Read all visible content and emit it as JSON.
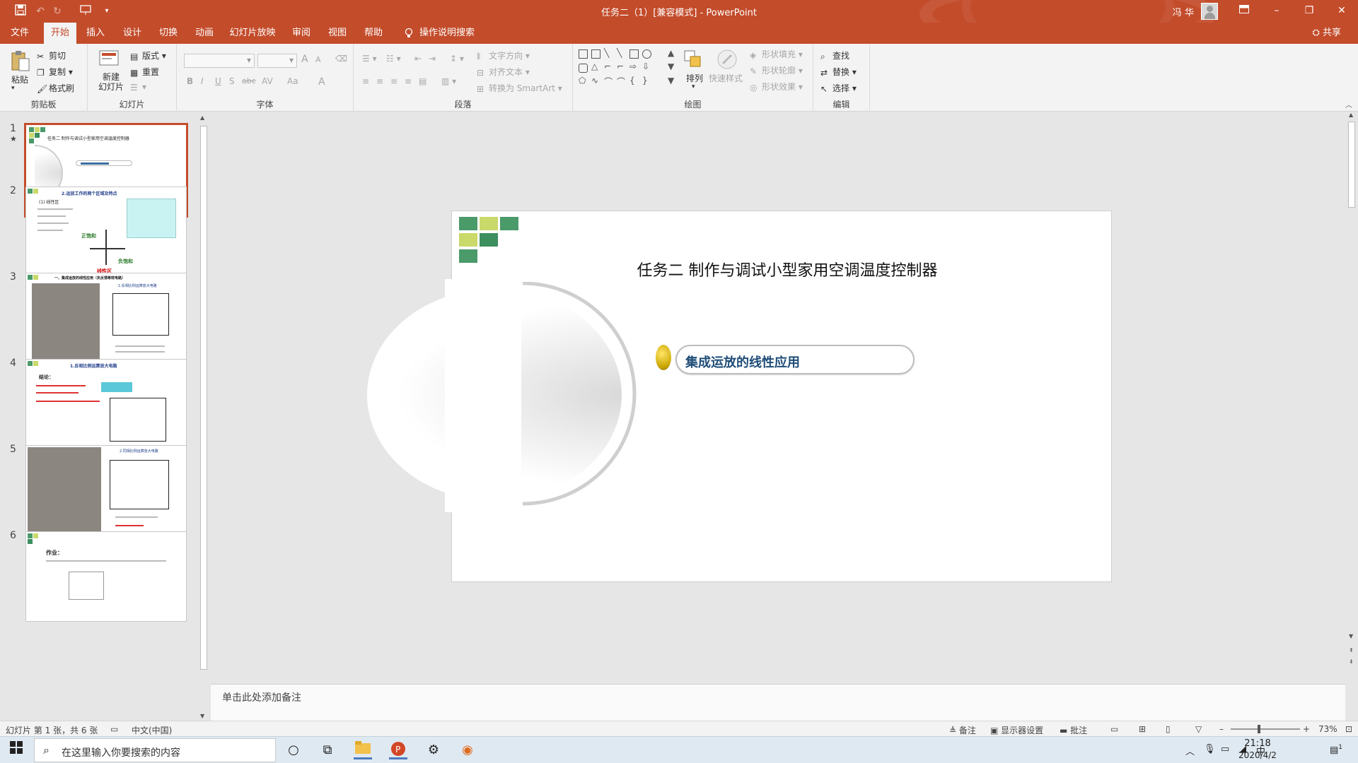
{
  "window": {
    "title": "任务二（1）[兼容模式] - PowerPoint",
    "user_name": "冯 华"
  },
  "quick_access": [
    "save-icon",
    "undo-icon",
    "redo-icon",
    "slideshow-start-icon",
    "customize-icon"
  ],
  "tabs": [
    "文件",
    "开始",
    "插入",
    "设计",
    "切换",
    "动画",
    "幻灯片放映",
    "审阅",
    "视图",
    "帮助",
    "操作说明搜索"
  ],
  "active_tab": "开始",
  "share_label": "共享",
  "ribbon": {
    "clipboard": {
      "paste": "粘贴",
      "cut": "剪切",
      "copy": "复制",
      "format_painter": "格式刷",
      "label": "剪贴板"
    },
    "slides": {
      "new_slide": "新建\n幻灯片",
      "layout": "版式",
      "reset": "重置",
      "label": "幻灯片"
    },
    "font": {
      "label": "字体",
      "bold": "B",
      "italic": "I",
      "underline": "U",
      "shadow": "S",
      "strike": "abc",
      "spacing": "AV",
      "case": "Aa",
      "color": "A",
      "grow": "A",
      "shrink": "A"
    },
    "paragraph": {
      "text_direction": "文字方向",
      "align_text": "对齐文本",
      "smartart": "转换为 SmartArt",
      "label": "段落"
    },
    "drawing": {
      "arrange": "排列",
      "quick_styles": "快速样式",
      "shape_fill": "形状填充",
      "shape_outline": "形状轮廓",
      "shape_effects": "形状效果",
      "label": "绘图"
    },
    "editing": {
      "find": "查找",
      "replace": "替换",
      "select": "选择",
      "label": "编辑"
    }
  },
  "thumbnails": [
    {
      "num": "1",
      "star": "★",
      "title": "任务二 制作与调试小型家用空调温度控制器"
    },
    {
      "num": "2",
      "title": "2.运放工作的两个区域及特点",
      "label_left": "(1) 线性区",
      "label_bottom": "线性区",
      "sat_pos": "正饱和",
      "sat_neg": "负饱和"
    },
    {
      "num": "3",
      "title": "一、集成运放的线性应用（负反馈等效电路）",
      "subtitle": "1.反相比例运算放大电路"
    },
    {
      "num": "4",
      "title": "1.反相比例运算放大电路",
      "note": "结论："
    },
    {
      "num": "5",
      "title": "2.同相比例运算放大电路"
    },
    {
      "num": "6",
      "title": "作业："
    }
  ],
  "slide": {
    "title": "任务二 制作与调试小型家用空调温度控制器",
    "pill_text": "集成运放的线性应用",
    "colors": {
      "dark_green": "#4a9a6a",
      "light_green": "#c9d96a",
      "mid_green": "#3d8f5e"
    }
  },
  "notes_placeholder": "单击此处添加备注",
  "status": {
    "slide_info": "幻灯片 第 1 张，共 6 张",
    "language": "中文(中国)",
    "notes": "备注",
    "display_settings": "显示器设置",
    "comments": "批注",
    "zoom": "73%"
  },
  "taskbar": {
    "search_placeholder": "在这里输入你要搜索的内容",
    "ime": "中",
    "time": "21:18",
    "date": "2020/4/2",
    "notification_count": "1"
  }
}
